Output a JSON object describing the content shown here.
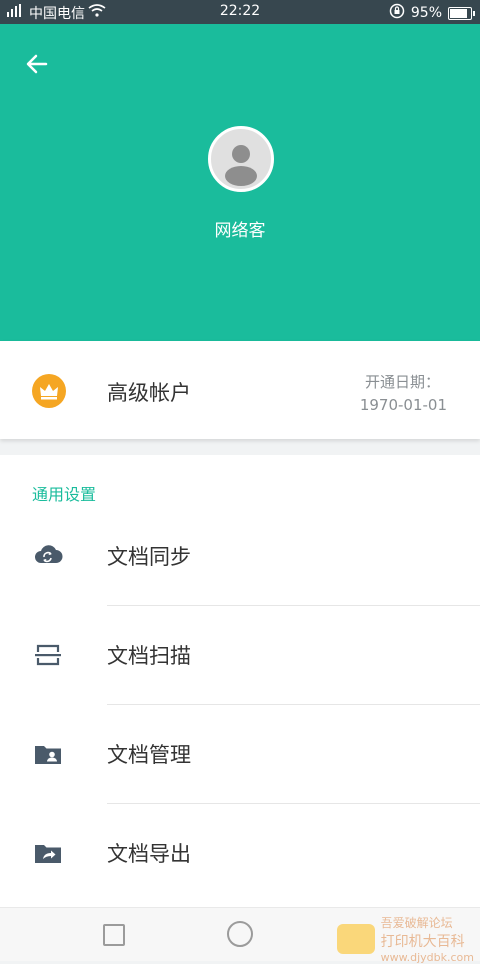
{
  "status_bar": {
    "carrier": "中国电信",
    "time": "22:22",
    "battery": "95%",
    "battery_level": 0.95
  },
  "profile": {
    "username": "网络客"
  },
  "account": {
    "type": "高级帐户",
    "open_date_label": "开通日期：",
    "open_date_value": "1970-01-01"
  },
  "settings": {
    "section_title": "通用设置",
    "items": [
      {
        "label": "文档同步",
        "icon": "cloud-sync-icon"
      },
      {
        "label": "文档扫描",
        "icon": "scan-icon"
      },
      {
        "label": "文档管理",
        "icon": "folder-user-icon"
      },
      {
        "label": "文档导出",
        "icon": "folder-share-icon"
      }
    ]
  },
  "watermark": {
    "line1": "吾爱破解论坛",
    "line2": "打印机大百科",
    "line3": "www.djydbk.com"
  },
  "colors": {
    "accent": "#1abc9c",
    "icon": "#4a5a6a",
    "crown": "#f5a623"
  }
}
